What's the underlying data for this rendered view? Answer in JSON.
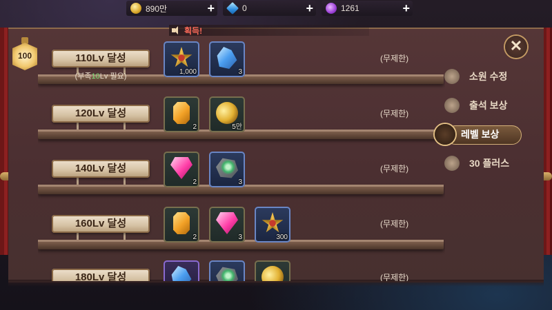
{
  "currencies": [
    {
      "name": "gold",
      "value": "890만",
      "icon": "gold-coin-icon"
    },
    {
      "name": "diamond",
      "value": "0",
      "icon": "blue-diamond-icon"
    },
    {
      "name": "orb",
      "value": "1261",
      "icon": "purple-orb-icon"
    }
  ],
  "notice": {
    "text": "획득!"
  },
  "level_badge": {
    "value": "100"
  },
  "rewards": [
    {
      "title": "110Lv 달성",
      "requirement": {
        "prefix": "(부족",
        "highlight": "10",
        "suffix": "Lv 필요)"
      },
      "items": [
        {
          "icon": "gold-star-medal-icon",
          "qty": "1,000",
          "frame": "blue"
        },
        {
          "icon": "blue-crystal-ore-icon",
          "qty": "3",
          "frame": "blue"
        }
      ],
      "limit": "(무제한)"
    },
    {
      "title": "120Lv 달성",
      "items": [
        {
          "icon": "amber-gem-icon",
          "qty": "2",
          "frame": "green"
        },
        {
          "icon": "gold-coins-icon",
          "qty": "5만",
          "frame": "green"
        }
      ],
      "limit": "(무제한)"
    },
    {
      "title": "140Lv 달성",
      "items": [
        {
          "icon": "pink-diamond-icon",
          "qty": "2",
          "frame": "green"
        },
        {
          "icon": "green-ore-icon",
          "qty": "3",
          "frame": "blue"
        }
      ],
      "limit": "(무제한)"
    },
    {
      "title": "160Lv 달성",
      "items": [
        {
          "icon": "amber-gem-icon",
          "qty": "2",
          "frame": "green"
        },
        {
          "icon": "pink-diamond-icon",
          "qty": "3",
          "frame": "green"
        },
        {
          "icon": "gold-star-medal-icon",
          "qty": "300",
          "frame": "blue"
        }
      ],
      "limit": "(무제한)"
    },
    {
      "title": "180Lv 달성",
      "items": [
        {
          "icon": "blue-crystal-icon",
          "qty": "",
          "frame": "purple"
        },
        {
          "icon": "green-ore-icon",
          "qty": "",
          "frame": "blue"
        },
        {
          "icon": "gold-coins-icon",
          "qty": "",
          "frame": "green"
        }
      ],
      "limit": "(무제한)"
    }
  ],
  "menu": {
    "items": [
      {
        "label": "소원 수정",
        "icon": "wish-statue-icon"
      },
      {
        "label": "출석 보상",
        "icon": "attendance-shield-icon"
      },
      {
        "label": "레벨 보상",
        "icon": "level-chest-icon",
        "active": true
      },
      {
        "label": "30 플러스",
        "icon": "plus-card-icon"
      }
    ]
  },
  "close": {
    "label": "✕"
  }
}
